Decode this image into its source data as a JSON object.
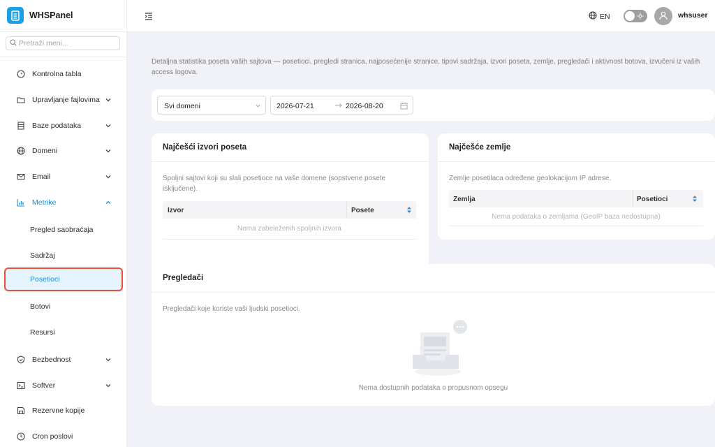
{
  "app": {
    "title": "WHSPanel"
  },
  "sidebar": {
    "search_placeholder": "Pretraži meni...",
    "items": [
      {
        "label": "Kontrolna tabla"
      },
      {
        "label": "Upravljanje fajlovima"
      },
      {
        "label": "Baze podataka"
      },
      {
        "label": "Domeni"
      },
      {
        "label": "Email"
      },
      {
        "label": "Metrike"
      },
      {
        "label": "Bezbednost"
      },
      {
        "label": "Softver"
      },
      {
        "label": "Rezervne kopije"
      },
      {
        "label": "Cron poslovi"
      }
    ],
    "metrics_sub": [
      {
        "label": "Pregled saobraćaja"
      },
      {
        "label": "Sadržaj"
      },
      {
        "label": "Posetioci"
      },
      {
        "label": "Botovi"
      },
      {
        "label": "Resursi"
      }
    ]
  },
  "topbar": {
    "language": "EN",
    "username": "whsuser"
  },
  "page": {
    "description": "Detaljna statistika poseta vaših sajtova — posetioci, pregledi stranica, najposećenije stranice, tipovi sadržaja, izvori poseta, zemlje, pregledači i aktivnost botova, izvučeni iz vaših access logova."
  },
  "filters": {
    "domain": "Svi domeni",
    "date_from": "2026-07-21",
    "date_to": "2026-08-20"
  },
  "sources_card": {
    "title": "Najčešći izvori poseta",
    "description": "Spoljni sajtovi koji su slali posetioce na vaše domene (sopstvene posete isključene).",
    "col_source": "Izvor",
    "col_visits": "Posete",
    "empty": "Nema zabeleženih spoljnih izvora"
  },
  "countries_card": {
    "title": "Najčešće zemlje",
    "description": "Zemlje posetilaca određene geolokacijom IP adrese.",
    "col_country": "Zemlja",
    "col_visitors": "Posetioci",
    "empty": "Nema podataka o zemljama (GeoIP baza nedostupna)"
  },
  "browsers_card": {
    "title": "Pregledači",
    "description": "Pregledači koje koriste vaši ljudski posetioci.",
    "empty": "Nema dostupnih podataka o propusnom opsegu"
  },
  "colors": {
    "accent": "#1a9fe3",
    "highlight_border": "#e8503c",
    "active_bg": "#e6f4fd"
  }
}
